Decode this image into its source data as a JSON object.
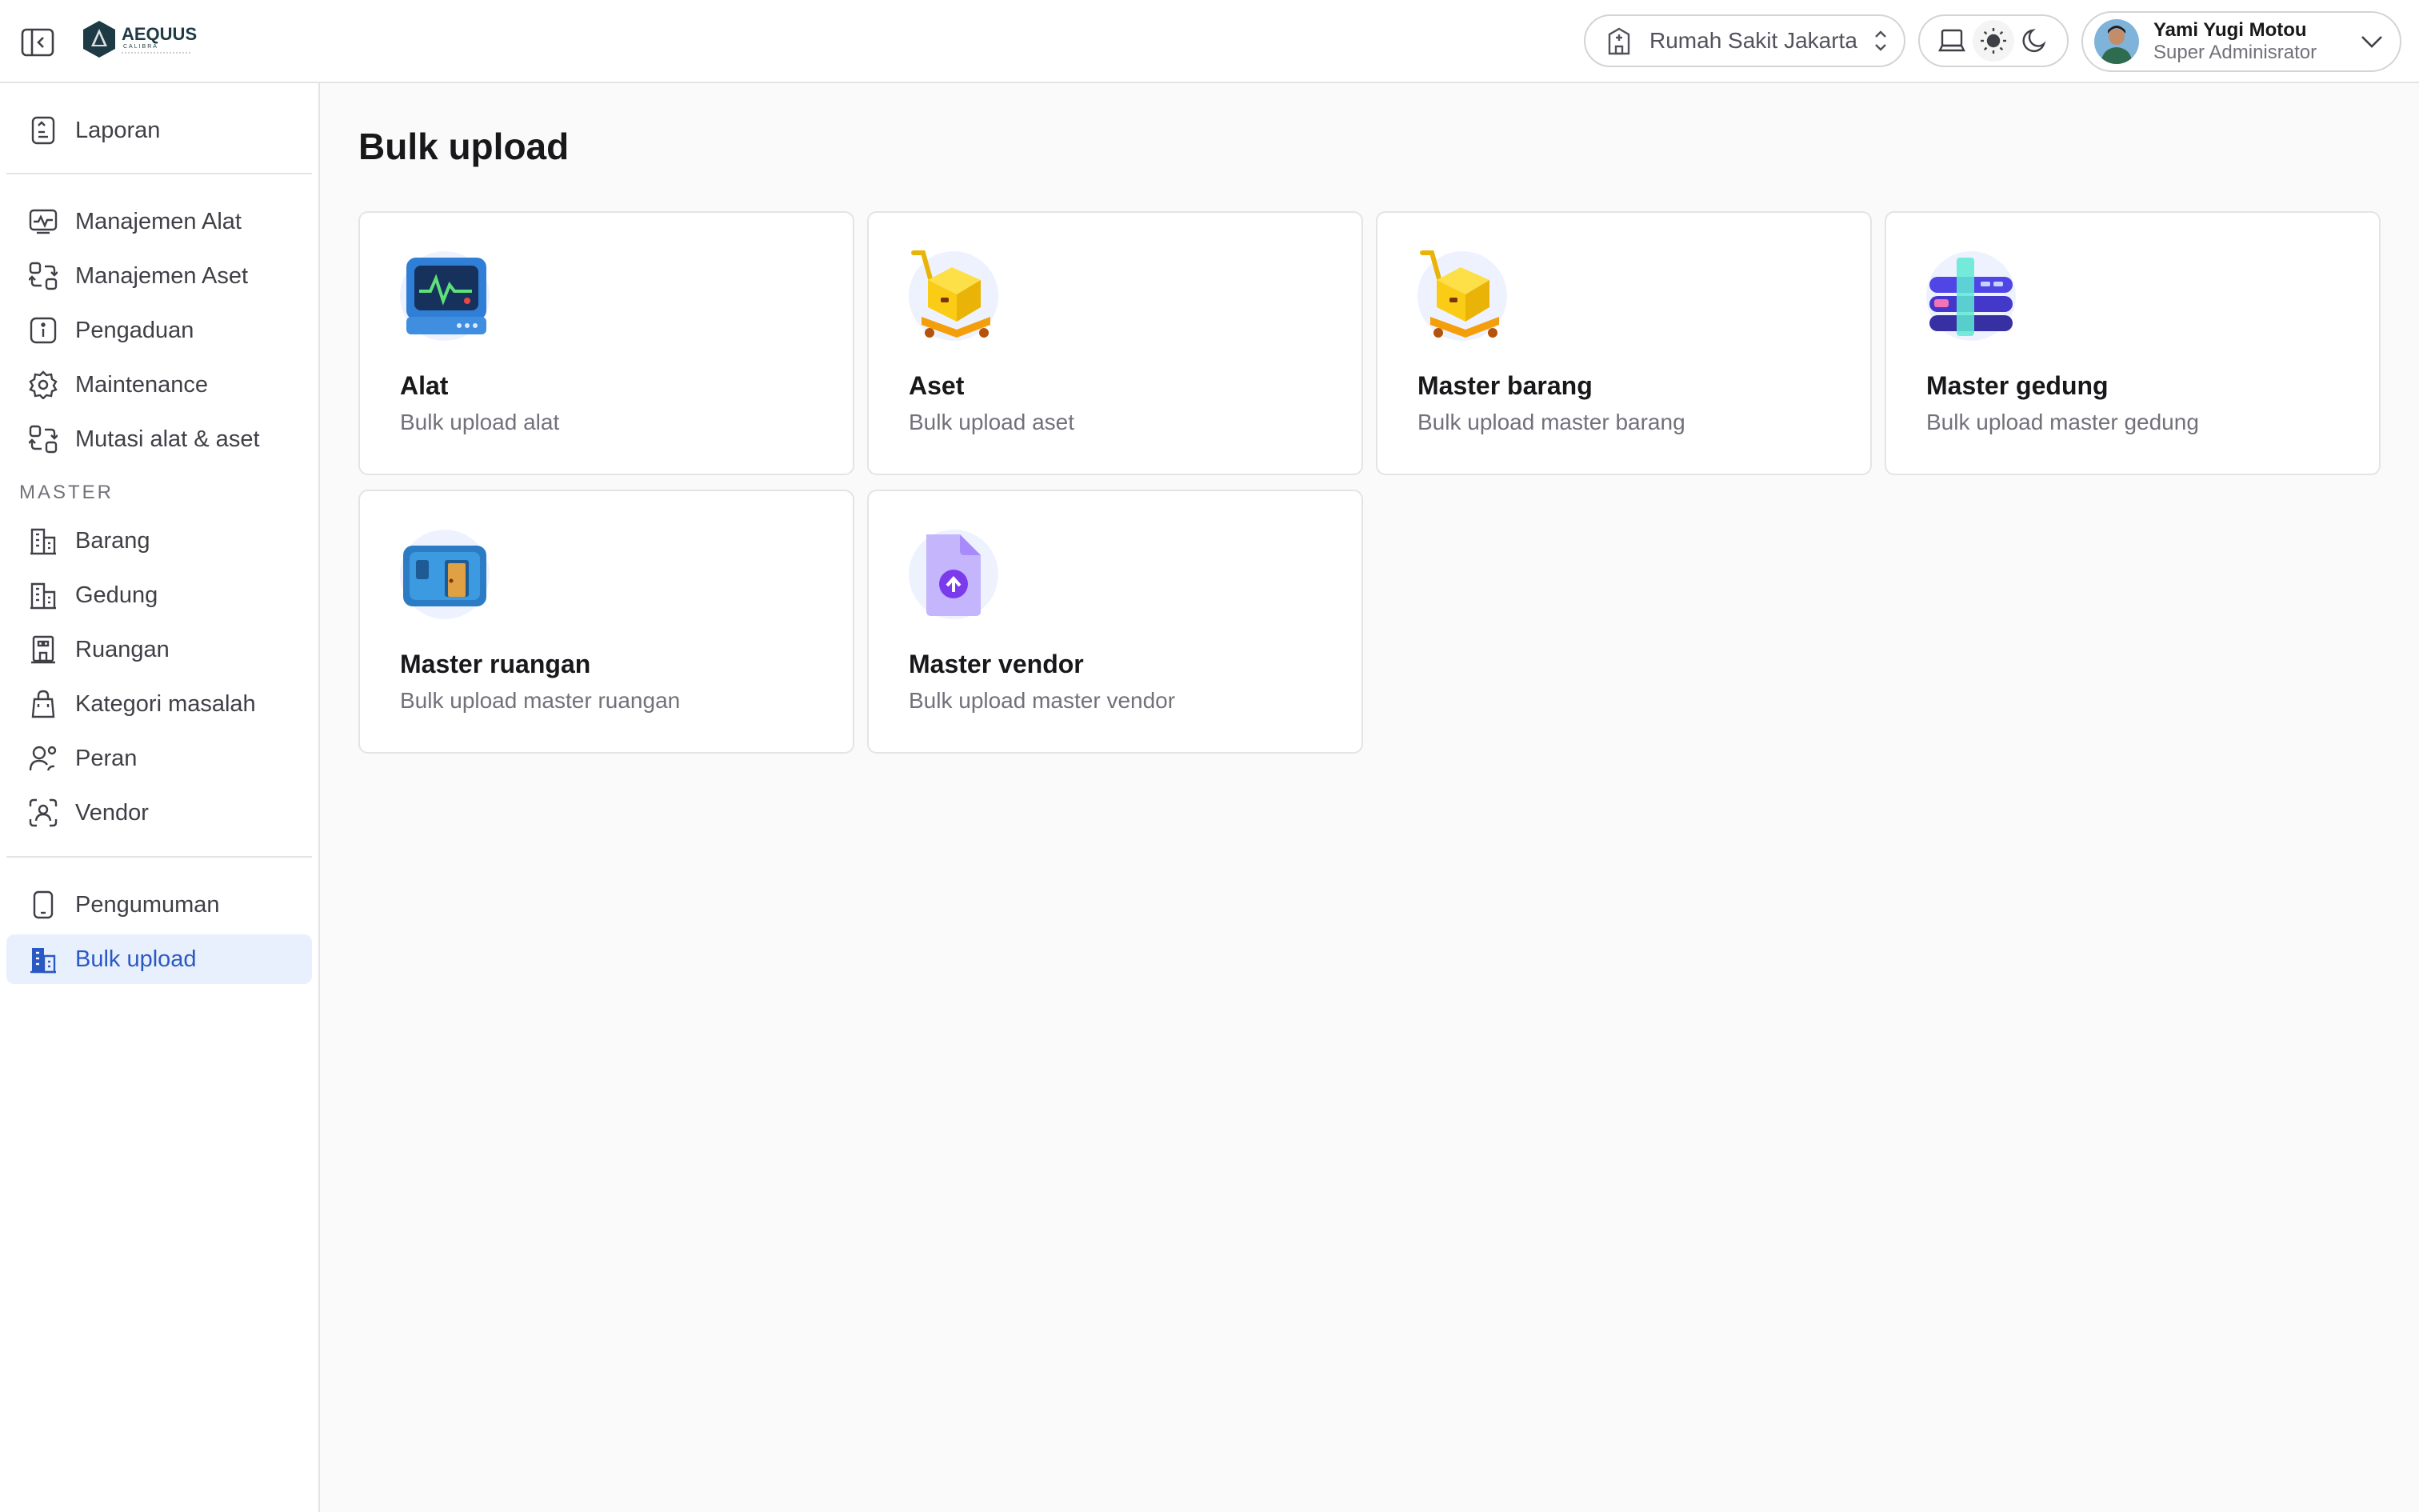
{
  "header": {
    "hospital": "Rumah Sakit Jakarta",
    "user": {
      "name": "Yami Yugi Motou",
      "role": "Super Adminisrator"
    },
    "logo": {
      "brand": "AEQUUS",
      "sub": "CALIBRA"
    }
  },
  "sidebar": {
    "top_items": [
      {
        "label": "Laporan",
        "icon": "report-icon"
      }
    ],
    "main_items": [
      {
        "label": "Manajemen Alat",
        "icon": "monitor-icon"
      },
      {
        "label": "Manajemen Aset",
        "icon": "swap-icon"
      },
      {
        "label": "Pengaduan",
        "icon": "info-icon"
      },
      {
        "label": "Maintenance",
        "icon": "gear-icon"
      },
      {
        "label": "Mutasi alat & aset",
        "icon": "swap-icon"
      }
    ],
    "master_label": "MASTER",
    "master_items": [
      {
        "label": "Barang",
        "icon": "building-icon"
      },
      {
        "label": "Gedung",
        "icon": "building-icon"
      },
      {
        "label": "Ruangan",
        "icon": "room-icon"
      },
      {
        "label": "Kategori masalah",
        "icon": "bag-icon"
      },
      {
        "label": "Peran",
        "icon": "users-icon"
      },
      {
        "label": "Vendor",
        "icon": "scan-user-icon"
      }
    ],
    "bottom_items": [
      {
        "label": "Pengumuman",
        "icon": "phone-icon"
      },
      {
        "label": "Bulk upload",
        "icon": "building-icon",
        "active": true
      }
    ]
  },
  "page": {
    "title": "Bulk upload",
    "cards": [
      {
        "title": "Alat",
        "desc": "Bulk upload alat",
        "icon": "monitor-illustration"
      },
      {
        "title": "Aset",
        "desc": "Bulk upload aset",
        "icon": "cart-box-illustration"
      },
      {
        "title": "Master barang",
        "desc": "Bulk upload master barang",
        "icon": "cart-box-illustration"
      },
      {
        "title": "Master gedung",
        "desc": "Bulk upload master gedung",
        "icon": "database-illustration"
      },
      {
        "title": "Master ruangan",
        "desc": "Bulk upload master ruangan",
        "icon": "room-illustration"
      },
      {
        "title": "Master vendor",
        "desc": "Bulk upload master vendor",
        "icon": "file-upload-illustration"
      }
    ]
  },
  "colors": {
    "accent": "#2b59c3",
    "active_bg": "#e8f0fe",
    "border": "#e4e4e7",
    "background": "#fafafa"
  }
}
